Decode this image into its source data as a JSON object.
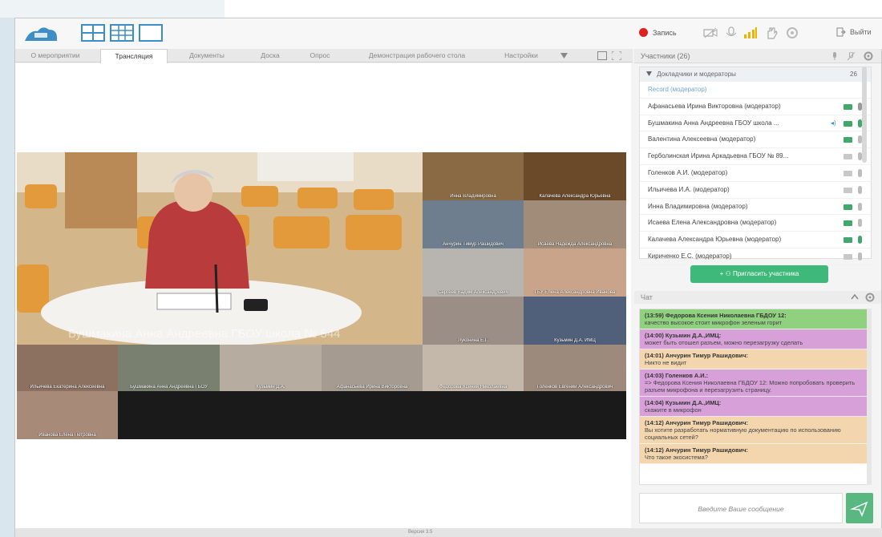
{
  "toolbar": {
    "record_label": "Запись",
    "exit_label": "Выйти"
  },
  "tabs": [
    {
      "label": "О мероприятии"
    },
    {
      "label": "Трансляция"
    },
    {
      "label": "Документы"
    },
    {
      "label": "Доска"
    },
    {
      "label": "Опрос"
    },
    {
      "label": "Демонстрация рабочего стола"
    },
    {
      "label": "Настройки"
    }
  ],
  "video": {
    "main_name": "Бушмакина Анна Андреевна ГБОУ школа № 544",
    "thumbs": [
      "Инна Владимировна",
      "Калачева Александра Юрьевна",
      "Анчурин Тимур Рашидович",
      "Исаева Надежда Александровна",
      "Сергеев Вадим Александрович",
      "ГБУ Елена Александровна Иванова",
      "Луконина Е.Г.",
      "Кузьмин Д.А. ИМЦ",
      "Ильичева Екатерина Алексеевна",
      "Бушмакина Анна Андреевна ГБОУ",
      "Кузьмин Д.А.",
      "Афанасьева Ирина Викторовна",
      "Федорова Ксения Николаевна",
      "Голенков Евгений Александрович",
      "Иванова Елена Петровна"
    ]
  },
  "participants": {
    "header": "Участники (26)",
    "group_label": "Докладчики и модераторы",
    "group_count": "26",
    "items": [
      "Record (модератор)",
      "Афанасьева Ирина Викторовна (модератор)",
      "Бушмакина Анна Андреевна ГБОУ школа ...",
      "Валентина Алексеевна (модератор)",
      "Герболинская Ирина Аркадьевна ГБОУ № 89...",
      "Голенков А.И. (модератор)",
      "Ильичева И.А. (модератор)",
      "Инна Владимировна (модератор)",
      "Исаева Елена Александровна (модератор)",
      "Калачева Александра Юрьевна (модератор)",
      "Кириченко Е.С. (модератор)"
    ],
    "invite_label": "Пригласить участника"
  },
  "chat": {
    "header": "Чат",
    "placeholder": "Введите Ваше сообщение",
    "messages": [
      {
        "who": "(13:59) Федорова Ксения Николаевна ГБДОУ 12:",
        "text": "качество высокое стоит микрофон зеленым горит",
        "color": "#8fd17f"
      },
      {
        "who": "(14:00) Кузьмин Д.А.,ИМЦ:",
        "text": "может быть отошел разъем, можно перезагрузку сделать",
        "color": "#d7a0d8"
      },
      {
        "who": "(14:01) Анчурин Тимур Рашидович:",
        "text": "Никто не видит",
        "color": "#f4d6ae"
      },
      {
        "who": "(14:03) Голенков А.И.:",
        "text": "=> Федорова Ксения Николаевна ГБДОУ 12: Можно попробовать проверить разъем микрофона и перезагрузить страницу.",
        "color": "#d7a0d8"
      },
      {
        "who": "(14:04) Кузьмин Д.А.,ИМЦ:",
        "text": "скажите в микрофон",
        "color": "#d7a0d8"
      },
      {
        "who": "(14:12) Анчурин Тимур Рашидович:",
        "text": "Вы хотите разработать нормативную документацию по использованию социальных сетей?",
        "color": "#f4d6ae"
      },
      {
        "who": "(14:12) Анчурин Тимур Рашидович:",
        "text": "Что такое экосистема?",
        "color": "#f4d6ae"
      }
    ]
  },
  "status_bar": {
    "center": "Версия 3.5"
  },
  "colors": {
    "accent": "#3d8ec7",
    "record": "#e02020",
    "cam_on": "#3fa86a",
    "mic": "#9a9a9a",
    "invite": "#3fb97a",
    "send": "#58b87f"
  }
}
